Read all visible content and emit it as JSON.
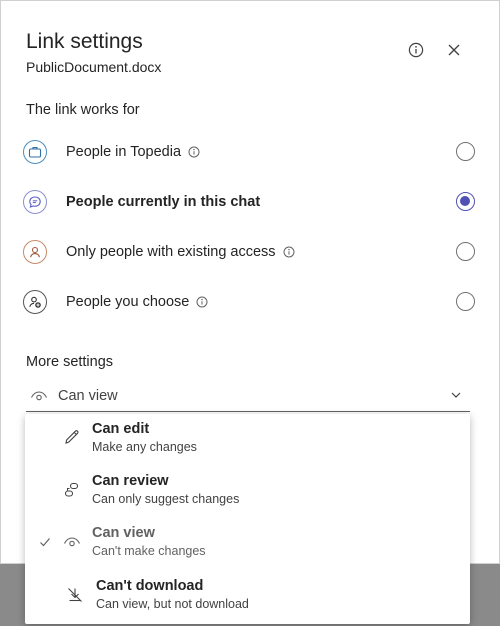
{
  "dialog": {
    "title": "Link settings",
    "subtitle": "PublicDocument.docx",
    "info_icon": "info-icon",
    "close_icon": "close-icon"
  },
  "link_works_for": {
    "heading": "The link works for",
    "options": [
      {
        "label": "People in Topedia",
        "icon": "briefcase-icon",
        "has_info": true,
        "selected": false
      },
      {
        "label": "People currently in this chat",
        "icon": "chat-icon",
        "has_info": false,
        "selected": true
      },
      {
        "label": "Only people with existing access",
        "icon": "person-icon",
        "has_info": true,
        "selected": false
      },
      {
        "label": "People you choose",
        "icon": "people-add-icon",
        "has_info": true,
        "selected": false
      }
    ]
  },
  "more_settings": {
    "heading": "More settings",
    "permission_select": {
      "value": "Can view",
      "icon": "eye-icon"
    }
  },
  "permission_menu": {
    "items": [
      {
        "title": "Can edit",
        "desc": "Make any changes",
        "icon": "pencil-icon",
        "checked": false
      },
      {
        "title": "Can review",
        "desc": "Can only suggest changes",
        "icon": "review-icon",
        "checked": false
      },
      {
        "title": "Can view",
        "desc": "Can't make changes",
        "icon": "eye-icon",
        "checked": true
      },
      {
        "title": "Can't download",
        "desc": "Can view, but not download",
        "icon": "no-download-icon",
        "checked": false
      }
    ]
  },
  "colors": {
    "accent": "#4f52b2",
    "text": "#242424",
    "muted": "#616161"
  }
}
